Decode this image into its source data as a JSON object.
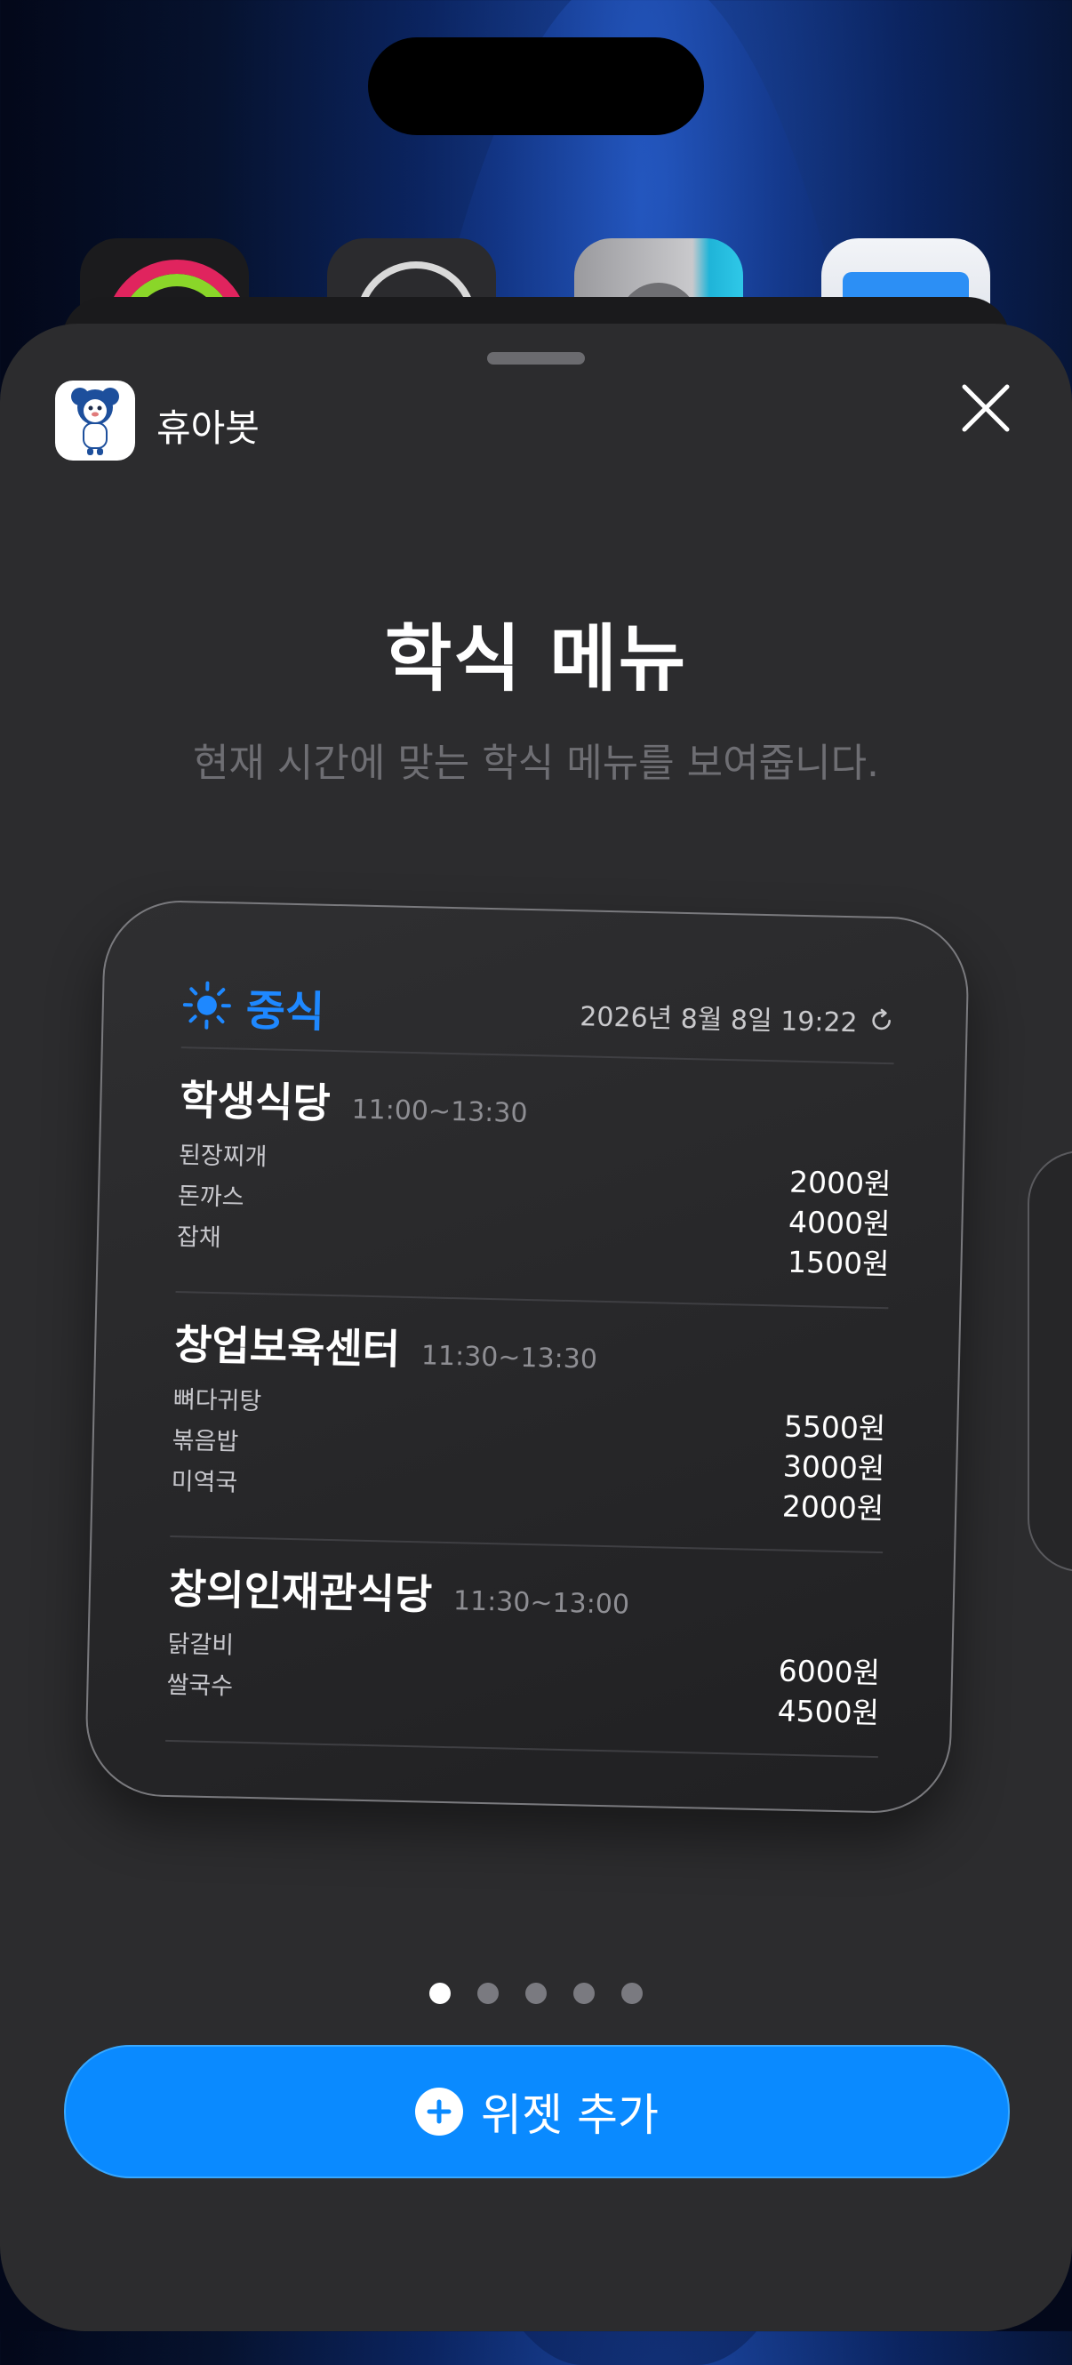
{
  "app": {
    "name": "휴아봇"
  },
  "sheet": {
    "title": "학식 메뉴",
    "subtitle": "현재 시간에 맞는 학식 메뉴를 보여줍니다.",
    "add_button_label": "위젯 추가",
    "page_count": 5,
    "active_page": 1
  },
  "widget": {
    "meal_label": "중식",
    "timestamp": "2026년 8월 8일 19:22",
    "cafeterias": [
      {
        "name": "학생식당",
        "hours": "11:00~13:30",
        "items": [
          {
            "name": "된장찌개",
            "price": "2000원"
          },
          {
            "name": "돈까스",
            "price": "4000원"
          },
          {
            "name": "잡채",
            "price": "1500원"
          }
        ]
      },
      {
        "name": "창업보육센터",
        "hours": "11:30~13:30",
        "items": [
          {
            "name": "뼈다귀탕",
            "price": "5500원"
          },
          {
            "name": "볶음밥",
            "price": "3000원"
          },
          {
            "name": "미역국",
            "price": "2000원"
          }
        ]
      },
      {
        "name": "창의인재관식당",
        "hours": "11:30~13:00",
        "items": [
          {
            "name": "닭갈비",
            "price": "6000원"
          },
          {
            "name": "쌀국수",
            "price": "4500원"
          }
        ]
      }
    ]
  },
  "colors": {
    "accent": "#0a8aff",
    "meal_label": "#1e88ff",
    "sheet_bg": "#2c2c2e"
  },
  "icons": {
    "sun": "sun-icon",
    "refresh": "refresh-icon",
    "close": "close-icon",
    "plus": "plus-icon"
  }
}
